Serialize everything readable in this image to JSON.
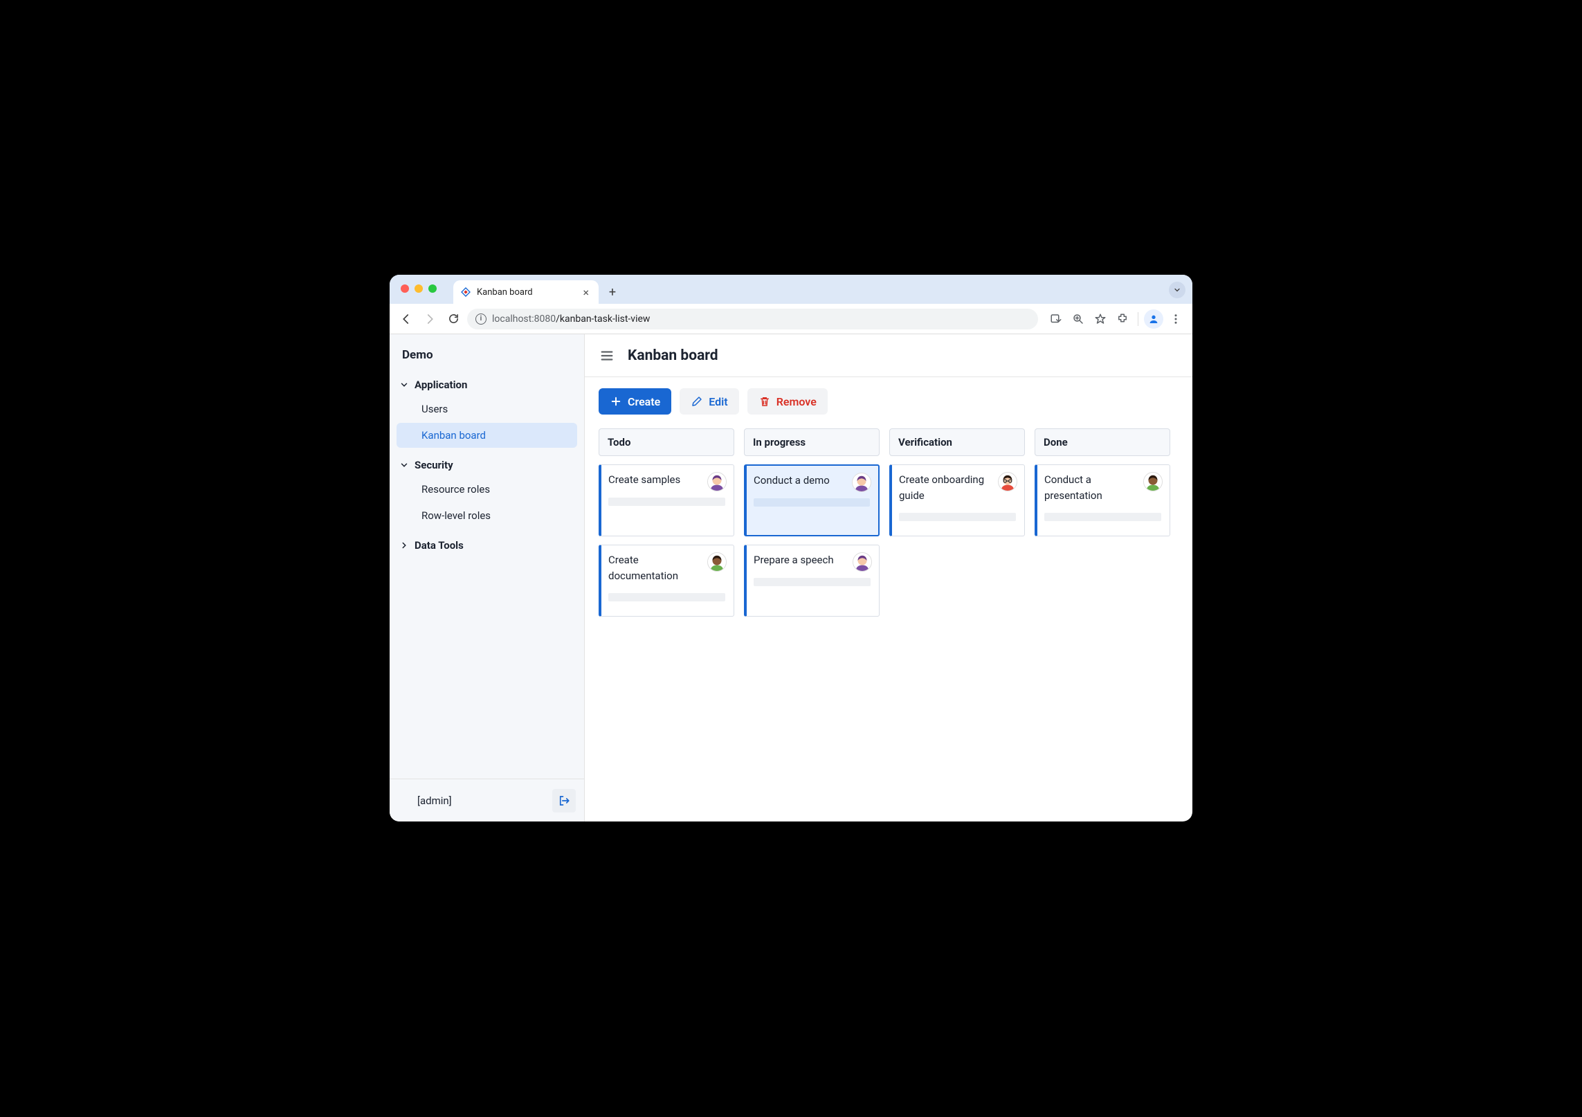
{
  "browser": {
    "tab_title": "Kanban board",
    "url_host": "localhost",
    "url_port": ":8080",
    "url_path": "/kanban-task-list-view"
  },
  "sidebar": {
    "brand": "Demo",
    "sections": [
      {
        "title": "Application",
        "expanded": true,
        "items": [
          {
            "label": "Users",
            "active": false
          },
          {
            "label": "Kanban board",
            "active": true
          }
        ]
      },
      {
        "title": "Security",
        "expanded": true,
        "items": [
          {
            "label": "Resource roles",
            "active": false
          },
          {
            "label": "Row-level roles",
            "active": false
          }
        ]
      },
      {
        "title": "Data Tools",
        "expanded": false,
        "items": []
      }
    ],
    "footer_user": "[admin]"
  },
  "header": {
    "title": "Kanban board"
  },
  "toolbar": {
    "create_label": "Create",
    "edit_label": "Edit",
    "remove_label": "Remove"
  },
  "board": {
    "columns": [
      {
        "title": "Todo",
        "cards": [
          {
            "title": "Create samples",
            "avatar": "a1",
            "selected": false
          },
          {
            "title": "Create documentation",
            "avatar": "a2",
            "selected": false
          }
        ]
      },
      {
        "title": "In progress",
        "cards": [
          {
            "title": "Conduct a demo",
            "avatar": "a1",
            "selected": true
          },
          {
            "title": "Prepare a speech",
            "avatar": "a1",
            "selected": false
          }
        ]
      },
      {
        "title": "Verification",
        "cards": [
          {
            "title": "Create onboarding guide",
            "avatar": "a3",
            "selected": false
          }
        ]
      },
      {
        "title": "Done",
        "cards": [
          {
            "title": "Conduct a presentation",
            "avatar": "a2",
            "selected": false
          }
        ]
      }
    ]
  },
  "avatars": {
    "a1": {
      "skin": "#f6c9a8",
      "hair": "#6a3b86",
      "shirt": "#7b4fa3"
    },
    "a2": {
      "skin": "#8a5a36",
      "hair": "#2b1a10",
      "shirt": "#6ab04c"
    },
    "a3": {
      "skin": "#f6c9a8",
      "hair": "#2b1a10",
      "shirt": "#e74c3c",
      "glasses": true
    }
  }
}
